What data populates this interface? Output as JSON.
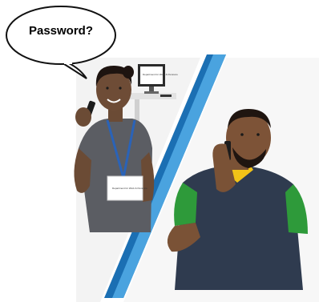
{
  "speech_bubble": {
    "text": "Password?"
  },
  "monitor_logo": {
    "text": "Department for Work & Pensions"
  },
  "lanyard_badge": {
    "text": "Department for Work & Pensions"
  },
  "colors": {
    "divider_stripe_dark": "#1b6fb3",
    "divider_stripe_light": "#4aa3df",
    "woman_top": "#5b5d63",
    "lanyard": "#2a63b8",
    "man_polo": "#2f3b4f",
    "polo_sleeve_green": "#2e9a3a",
    "polo_collar_yellow": "#f2c318"
  }
}
